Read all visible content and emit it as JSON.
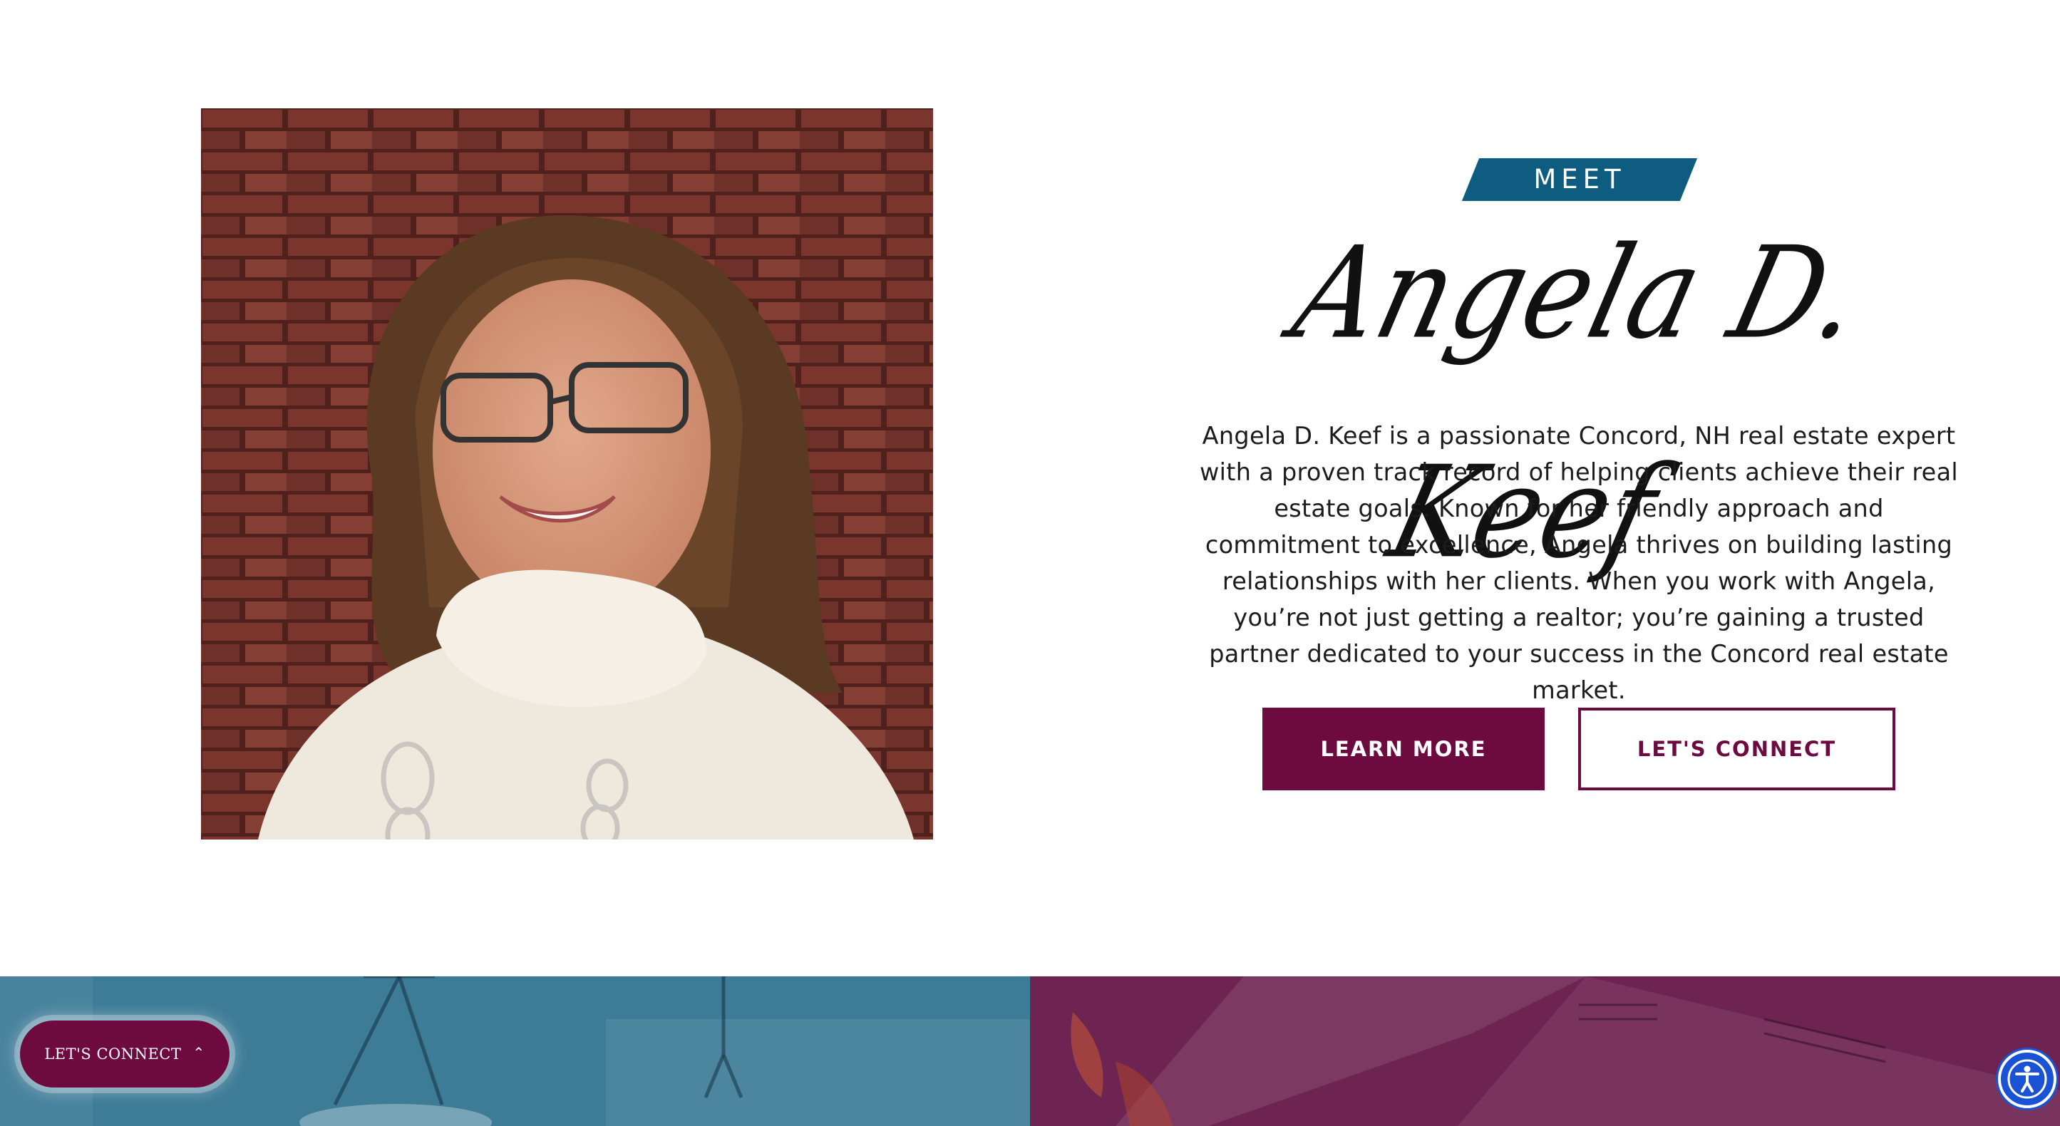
{
  "agent": {
    "meet_label": "MEET",
    "name_signature": "Angela D. Keef",
    "bio": "Angela D. Keef is a passionate Concord, NH real estate expert with a proven track record of helping clients achieve their real estate goals. Known for her friendly approach and commitment to excellence, Angela thrives on building lasting relationships with her clients. When you work with Angela, you’re not just getting a realtor; you’re gaining a trusted partner dedicated to your success in the Concord real estate market."
  },
  "buttons": {
    "learn_more": "LEARN MORE",
    "lets_connect": "LET'S CONNECT"
  },
  "floating_widget": {
    "label": "LET'S CONNECT",
    "icon": "chevron-up-icon"
  },
  "accessibility": {
    "icon": "accessibility-icon"
  },
  "colors": {
    "brand_burgundy": "#6d0a3f",
    "accent_teal": "#0e5c7f",
    "band_left": "#3d7b96",
    "band_right": "#6e2452",
    "a11y_blue": "#1a52d6"
  }
}
